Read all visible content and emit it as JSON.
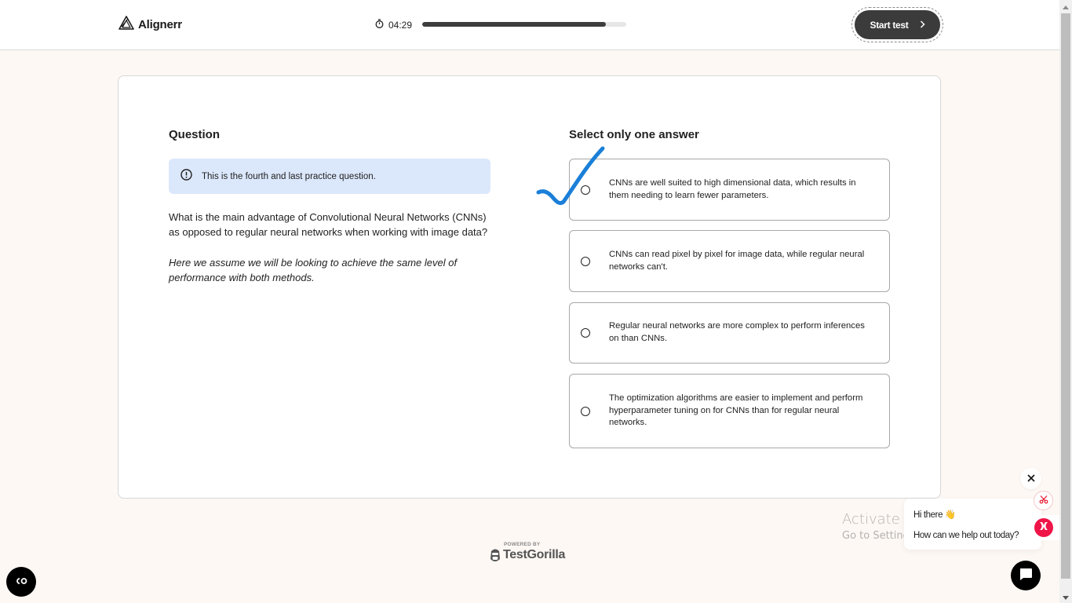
{
  "header": {
    "logo_text": "Aligner r",
    "logo_icon": "aligner-triangle-icon",
    "timer": {
      "icon": "stopwatch-icon",
      "text": "04:29"
    },
    "progress_fraction": 0.9,
    "start_button": {
      "label": "Start test",
      "icon": "chevron-right-icon"
    }
  },
  "question": {
    "heading": "Question",
    "notice": {
      "icon": "alert-circle-icon",
      "text": "This is the fourth and last practice question."
    },
    "text": "What is the main advantage of Convolutional Neural Networks (CNNs) as opposed to regular neural networks when working with image data?",
    "note": "Here we assume we will be looking to achieve the same level of performance with both methods."
  },
  "answers": {
    "heading": "Select only one answer",
    "options": [
      {
        "text": "CNNs are well suited to high dimensional data, which results in them needing to learn fewer parameters.",
        "selected": false
      },
      {
        "text": "CNNs can read pixel by pixel for image data, while regular neural networks can't.",
        "selected": false
      },
      {
        "text": "Regular neural networks are more complex to perform inferences on than CNNs.",
        "selected": false
      },
      {
        "text": "The optimization algorithms are easier to implement and perform hyperparameter tuning on for CNNs than for regular neural networks.",
        "selected": false
      }
    ],
    "annotation": {
      "type": "checkmark",
      "color": "#1a7fd8",
      "target_option": 0
    }
  },
  "footer": {
    "powered_by": "POWERED BY",
    "brand": "TestGorilla"
  },
  "chat": {
    "greeting": "Hi there 👋",
    "prompt": "How can we help out today?",
    "close_icon": "close-icon",
    "accent": "#ef1548"
  },
  "watermark": {
    "line1": "Activate Windows",
    "line2": "Go to Settings to activate Windows."
  }
}
